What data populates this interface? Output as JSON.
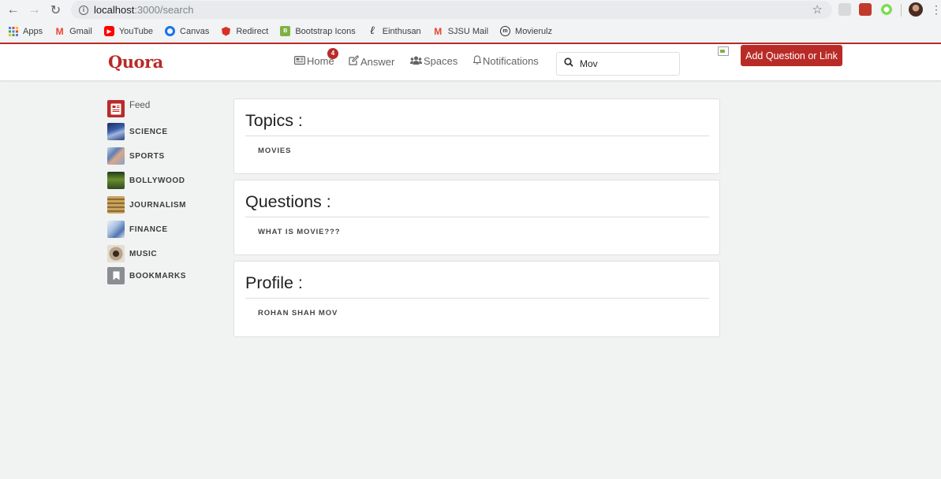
{
  "browser": {
    "url_host": "localhost",
    "url_path": ":3000/search",
    "bookmarks": [
      {
        "label": "Apps",
        "icon": "apps-grid-icon",
        "color": "#4285f4"
      },
      {
        "label": "Gmail",
        "icon": "gmail-icon",
        "color": "#ea4335"
      },
      {
        "label": "YouTube",
        "icon": "youtube-icon",
        "color": "#ff0000"
      },
      {
        "label": "Canvas",
        "icon": "canvas-icon",
        "color": "#1a73e8"
      },
      {
        "label": "Redirect",
        "icon": "redirect-icon",
        "color": "#d93025"
      },
      {
        "label": "Bootstrap Icons",
        "icon": "bootstrap-icon",
        "color": "#7cb342"
      },
      {
        "label": "Einthusan",
        "icon": "einthusan-icon",
        "color": "#202124"
      },
      {
        "label": "SJSU Mail",
        "icon": "sjsu-mail-icon",
        "color": "#ea4335"
      },
      {
        "label": "Movierulz",
        "icon": "movierulz-icon",
        "color": "#333333"
      }
    ]
  },
  "header": {
    "logo": "Quora",
    "nav": {
      "home": "Home",
      "answer": "Answer",
      "spaces": "Spaces",
      "notifications": "Notifications"
    },
    "home_badge": "4",
    "search_value": "Mov",
    "add_button": "Add Question or Link"
  },
  "sidebar": {
    "feed_label": "Feed",
    "items": [
      {
        "label": "SCIENCE"
      },
      {
        "label": "SPORTS"
      },
      {
        "label": "BOLLYWOOD"
      },
      {
        "label": "JOURNALISM"
      },
      {
        "label": "FINANCE"
      },
      {
        "label": "MUSIC"
      },
      {
        "label": "BOOKMARKS"
      }
    ]
  },
  "results": {
    "topics": {
      "heading": "Topics :",
      "items": [
        "MOVIES"
      ]
    },
    "questions": {
      "heading": "Questions :",
      "items": [
        "WHAT IS MOVIE???"
      ]
    },
    "profile": {
      "heading": "Profile :",
      "items": [
        "ROHAN SHAH MOV"
      ]
    }
  },
  "colors": {
    "brand": "#b92b27",
    "page_bg": "#f1f2f2"
  }
}
